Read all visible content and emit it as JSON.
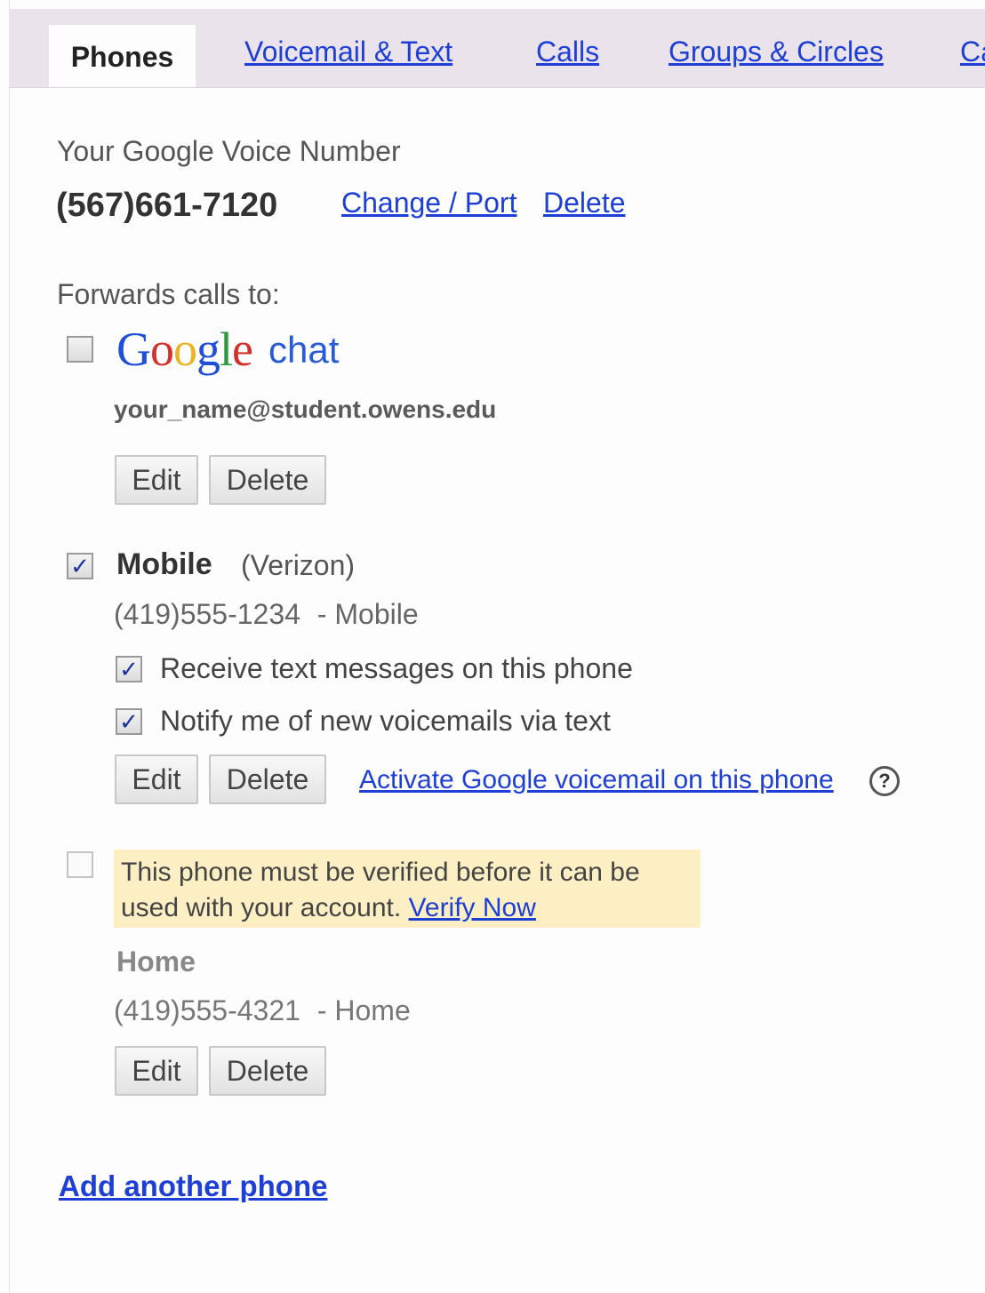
{
  "tabs": {
    "active": "Phones",
    "links": [
      "Voicemail & Text",
      "Calls",
      "Groups & Circles",
      "Ca"
    ]
  },
  "gv": {
    "label": "Your Google Voice Number",
    "number": "(567)661-7120",
    "change_port": "Change / Port",
    "delete": "Delete"
  },
  "forwards_label": "Forwards calls to:",
  "google_chat": {
    "logo_letters": [
      "G",
      "o",
      "o",
      "g",
      "l",
      "e"
    ],
    "logo_colors": [
      "#1f4fd8",
      "#d3322a",
      "#e8b524",
      "#1f4fd8",
      "#2b9a3f",
      "#d3322a"
    ],
    "chat_word": "chat",
    "email": "your_name@student.owens.edu",
    "checked": false,
    "edit": "Edit",
    "delete": "Delete"
  },
  "mobile": {
    "title": "Mobile",
    "carrier": "(Verizon)",
    "number": "(419)555-1234",
    "type_suffix": "- Mobile",
    "checked": true,
    "receive_text": "Receive text messages on this phone",
    "notify_voicemail": "Notify me of new voicemails via text",
    "edit": "Edit",
    "delete": "Delete",
    "activate_link": "Activate Google voicemail on this phone",
    "help_glyph": "?"
  },
  "home": {
    "checked": false,
    "warning_line1": "This phone must be verified before it can be",
    "warning_line2": "used with your account.",
    "verify_link": "Verify Now",
    "title": "Home",
    "number": "(419)555-4321",
    "type_suffix": "- Home",
    "edit": "Edit",
    "delete": "Delete"
  },
  "add_phone": "Add another phone",
  "check_glyph": "✓",
  "colors": {
    "link": "#1d3fd6",
    "tabbar_bg": "#ebe3ec",
    "warning_bg": "#fcefc4"
  }
}
